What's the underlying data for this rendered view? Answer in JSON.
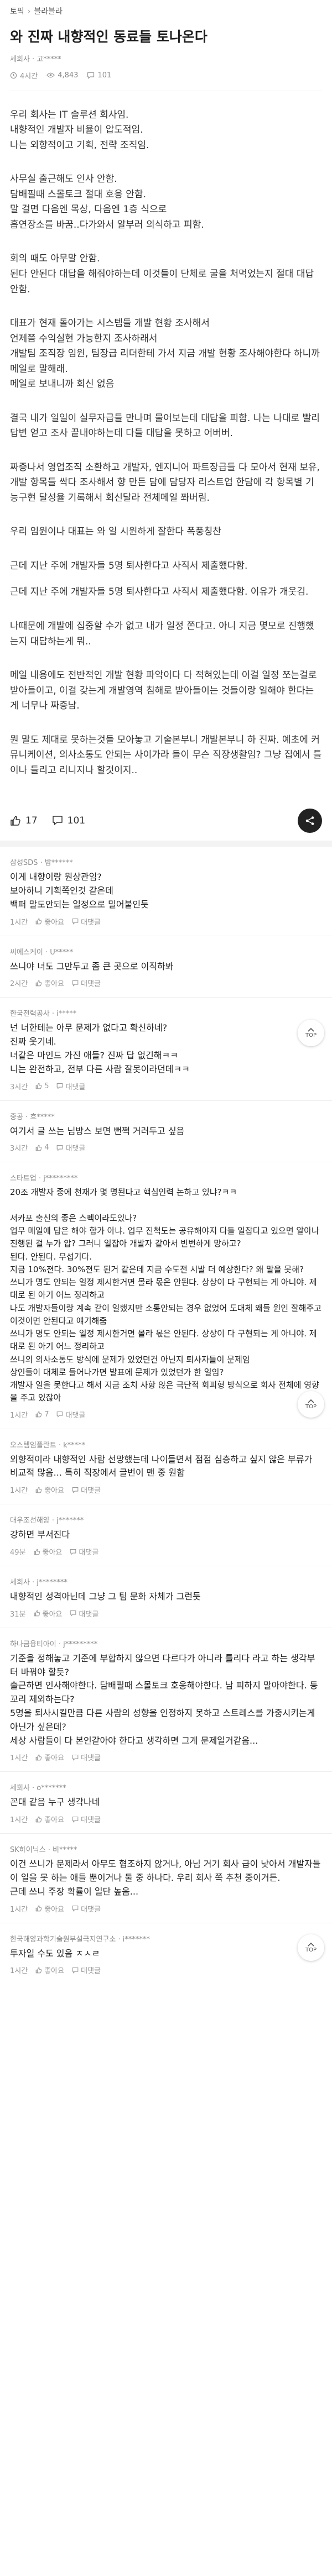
{
  "breadcrumb": {
    "home": "토픽",
    "board": "블라블라"
  },
  "post": {
    "title": "와 진짜 내향적인 동료들 토나온다",
    "author": "세회사 · 고*****",
    "time": "4시간",
    "views": "4,843",
    "comments": "101",
    "paragraphs": [
      "우리 회사는 IT 솔루션 회사임.\n내향적인 개발자 비율이 압도적임.\n나는 외향적이고 기획, 전략 조직임.",
      "사무실 출근해도 인사 안함.\n담배필때 스몰토크 절대 호응 안함.\n말 걸면 다음엔 목상, 다음엔 1층 식으로\n흡연장소를 바꿈..다가와서 알부러 의식하고 피함.",
      "회의 때도 아무말 안함.\n된다 안된다 대답을 해줘야하는데 이것들이 단체로 굴을 처먹었는지 절대 대답안함.",
      "대표가 현재 돌아가는 시스템들 개발 현황 조사해서\n언제쯤 수익실현 가능한지 조사하래서\n개발팀 조직장 임원, 팀장급 리더한테 가서 지금 개발 현황 조사해야한다 하니까 메일로 말해래.\n메일로 보내니까 회신 없음",
      "결국 내가 일일이 실무자급들 만나며 물어보는데 대답을 피함. 나는 나대로 빨리 답변 얻고 조사 끝내야하는데 다들 대답을 못하고 어버버.",
      "짜증나서 영업조직 소환하고 개발자, 엔지니어 파트장급들 다 모아서 현재 보유, 개발 항목들 싹다 조사해서 향 만든 담에 담당자 리스트업 한담에 각 항목별 기능구현 달성율 기록해서 회신달라 전체메일 쫘버림.",
      "우리 임원이나 대표는 와 일 시원하게 잘한다 폭풍칭찬",
      "근데 지난 주에 개발자들 5명 퇴사한다고 사직서 제출했다함.",
      "근데 지난 주에 개발자들 5명 퇴사한다고 사직서 제출했다함. 이유가 개웃김.",
      "나때문에 개발에 집중할 수가 없고 내가 일정 쫀다고. 아니 지금 몇모로 진행했는지 대답하는게 뭐..",
      "메일 내용에도 전반적인 개발 현황 파악이다 다 적혀있는데 이걸 일정 쪼는걸로 받아들이고, 이걸 갖는게 개발영역 침해로 받아들이는 것들이랑 일해야 한다는게 너무나 짜증남.",
      "뭔 말도 제대로 못하는것들 모아놓고 기술본부니 개발본부니 하 진짜. 예초에 커뮤니케이션, 의사소통도 안되는 사이가라 들이 무슨 직장생활임? 그냥 집에서 틀이나 들리고 리니지나 할것이지.."
    ],
    "likes": "17",
    "comment_count": "101"
  },
  "comments": [
    {
      "company": "삼성SDS · 밤******",
      "text": "이게 내향이랑 뭔상관임?\n보아하니 기획쪽인것 같은데\n백퍼 말도안되는 일정으로 밀어붙인듯",
      "time": "1시간",
      "likes": "좋아요",
      "reply": "대댓글"
    },
    {
      "company": "씨에스케이 · U*****",
      "text": "쓰니야 너도 그만두고 좀 큰 곳으로 이직하봐",
      "time": "2시간",
      "likes": "좋아요",
      "reply": "대댓글"
    },
    {
      "company": "한국전력공사 · i*****",
      "text": "넌 너한테는 아무 문제가 없다고 확신하네?\n진짜 웃기네.\n너같은 마인드 가진 애들? 진짜 답 없긴해ㅋㅋ\n니는 완전하고, 전부 다른 사람 잘못이라던데ㅋㅋ",
      "time": "3시간",
      "likes": "5",
      "reply": "대댓글"
    },
    {
      "company": "중공 · 흐*****",
      "text": "여기서 글 쓰는 님방스 보면 뻔쩍 거러두고 싶음",
      "time": "3시간",
      "likes": "4",
      "reply": "대댓글"
    },
    {
      "company": "스타트업 · j*********",
      "text": "20조 개발자 중에 천재가 몇 명된다고 핵심인력 논하고 있냐?ㅋㅋ\n\n서카포 출신의 좋은 스펙이라도있나?\n업무 메일에 답은 해야 함가 아냐. 업무 진척도는 공유해야지 다들 일잡다고 있으면 알아나 진행된 걸 누가 압? 그러니 일잡아 개발자 같아서 빈번하게 망하고?\n된다. 안된다. 무섭기다.\n지금 10%젼다. 30%젼도 된거 같은데 지금 수도전 시발 더 예상한다? 왜 말을 못해?\n쓰니가 명도 안되는 일정 제시한거면 몰라 몫은 안된다. 상상이 다 구현되는 게 아니야. 제대로 된 아기 어느 정리하고\n나도 개발자들이랑 계속 같이 일했지만 소통안되는 경우 없었어 도대체 왜들 원인 잘해주고 이것이면 안된다고 얘기해줌\n쓰니가 명도 안되는 일정 제시한거면 몰라 몫은 안된다. 상상이 다 구현되는 게 아니야. 제대로 된 아기 어느 정리하고\n쓰니의 의사소통도 방식에 문제가 있었던건 아닌지 퇴사자들이 문제임\n상인들이 대체로 들어나가면 발표에 문제가 있었던가 한 일임?\n개발자 일을 못한다고 해서 지금 조치 사항 않은 극단적 회피형 방식으로 회사 전체에 영향을 주고 있잖아",
      "time": "1시간",
      "likes": "7",
      "reply": "대댓글"
    },
    {
      "company": "오스템임플란트 · k*****",
      "text": "외향적이라 내향적인 사람 선망했는데 나이들면서 점점 심층하고 싶지 않은 부류가 비교적 많음... 특히 직장에서 글번이 맨 중 원함",
      "time": "1시간",
      "likes": "좋아요",
      "reply": "대댓글"
    },
    {
      "company": "대우조선해양 · j*******",
      "text": "강하면 부서진다",
      "time": "49분",
      "likes": "좋아요",
      "reply": "대댓글"
    },
    {
      "company": "세회사 · j********",
      "text": "내향적인 성격아닌데 그냥 그 팀 문화 자체가 그런듯",
      "time": "31분",
      "likes": "좋아요",
      "reply": "대댓글"
    },
    {
      "company": "하나금융티아이 · j*********",
      "text": "기준을 정해놓고 기준에 부합하지 않으면 다르다가 아니라 틀리다 라고 하는 생각부터 바꿔야 할듯?\n출근하면 인사해야한다. 담배필때 스몰토크 호응해야한다. 남 피하지 말아야한다. 등 꼬리 제외하는다?\n5명을 퇴사시킬만큼 다른 사람의 성향을 인정하지 못하고 스트레스를 가중시키는게 아닌가 싶은데?\n세상 사람들이 다 본인같아야 한다고 생각하면 그게 문제일거같음...",
      "time": "1시간",
      "likes": "좋아요",
      "reply": "대댓글"
    },
    {
      "company": "세회사 · o*******",
      "text": "꼰대 같음 누구 생각나네",
      "time": "1시간",
      "likes": "좋아요",
      "reply": "대댓글"
    },
    {
      "company": "SK하이닉스 · 비*****",
      "text": "이건 쓰니가 문제라서 아무도 협조하지 않거나, 아님 거기 회사 급이 낮아서 개발자들이 일을 못 하는 애들 뿐이거나 둘 중 하나다. 우리 회사 쪽 추천 중이거든.\n근데 쓰니 주장 확률이 일단 높음...",
      "time": "1시간",
      "likes": "좋아요",
      "reply": "대댓글"
    },
    {
      "company": "한국해양과학기술원부설극지연구소 · i*******",
      "text": "투자일 수도 있음 ㅈㅅㄹ",
      "time": "1시간",
      "likes": "좋아요",
      "reply": "대댓글"
    }
  ],
  "top_button": {
    "label": "TOP"
  }
}
